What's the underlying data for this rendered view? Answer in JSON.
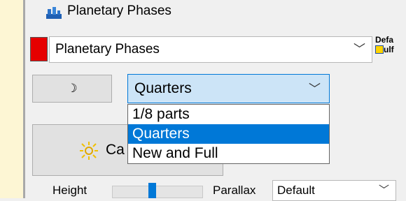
{
  "window": {
    "title": "Planetary Phases"
  },
  "toolbar": {
    "color_swatch": "#e60000",
    "set_value": "Planetary Phases",
    "default_label": "Defa",
    "default_label2": "ulf"
  },
  "phase": {
    "moon_symbol": "☽",
    "selected": "Quarters",
    "options": [
      "1/8 parts",
      "Quarters",
      "New and Full"
    ]
  },
  "calculate": {
    "label": "Ca"
  },
  "height": {
    "label": "Height",
    "slider_value": 0.5
  },
  "parallax": {
    "label": "Parallax",
    "value": "Default"
  },
  "icons": {
    "title": "planet-chart-icon",
    "sun": "sun-icon",
    "chevron": "chevron-down-icon"
  },
  "colors": {
    "accent": "#0078d7",
    "selected_bg": "#cce4f7"
  }
}
